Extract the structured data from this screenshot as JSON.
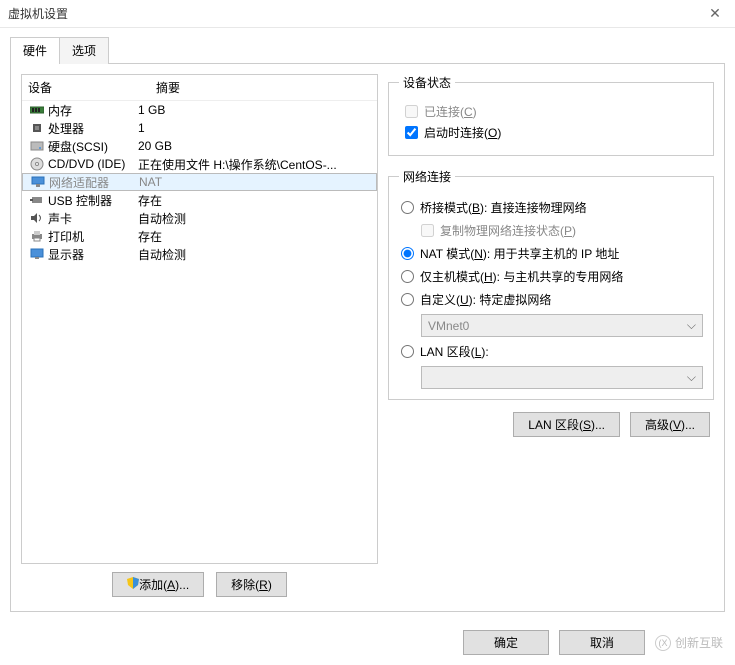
{
  "window": {
    "title": "虚拟机设置"
  },
  "tabs": {
    "hardware": "硬件",
    "options": "选项"
  },
  "cols": {
    "device": "设备",
    "summary": "摘要"
  },
  "devices": [
    {
      "name": "内存",
      "sum": "1 GB"
    },
    {
      "name": "处理器",
      "sum": "1"
    },
    {
      "name": "硬盘(SCSI)",
      "sum": "20 GB"
    },
    {
      "name": "CD/DVD (IDE)",
      "sum": "正在使用文件 H:\\操作系统\\CentOS-..."
    },
    {
      "name": "网络适配器",
      "sum": "NAT"
    },
    {
      "name": "USB 控制器",
      "sum": "存在"
    },
    {
      "name": "声卡",
      "sum": "自动检测"
    },
    {
      "name": "打印机",
      "sum": "存在"
    },
    {
      "name": "显示器",
      "sum": "自动检测"
    }
  ],
  "leftbtns": {
    "add": "添加(",
    "add_u": "A",
    "add_tail": ")...",
    "remove": "移除(",
    "remove_u": "R",
    "remove_tail": ")"
  },
  "status": {
    "legend": "设备状态",
    "connected": "已连接(",
    "connected_u": "C",
    "connected_tail": ")",
    "connect_on": "启动时连接(",
    "connect_on_u": "O",
    "connect_on_tail": ")"
  },
  "net": {
    "legend": "网络连接",
    "bridge": "桥接模式(",
    "bridge_u": "B",
    "bridge_tail": "): 直接连接物理网络",
    "replicate": "复制物理网络连接状态(",
    "replicate_u": "P",
    "replicate_tail": ")",
    "nat": "NAT 模式(",
    "nat_u": "N",
    "nat_tail": "): 用于共享主机的 IP 地址",
    "host": "仅主机模式(",
    "host_u": "H",
    "host_tail": "): 与主机共享的专用网络",
    "custom": "自定义(",
    "custom_u": "U",
    "custom_tail": "): 特定虚拟网络",
    "vmnet": "VMnet0",
    "lan": "LAN 区段(",
    "lan_u": "L",
    "lan_tail": "):"
  },
  "rbtns": {
    "lanseg": "LAN 区段(",
    "lanseg_u": "S",
    "lanseg_tail": ")...",
    "adv": "高级(",
    "adv_u": "V",
    "adv_tail": ")..."
  },
  "footer": {
    "ok": "确定",
    "cancel": "取消",
    "wm": "创新互联"
  }
}
